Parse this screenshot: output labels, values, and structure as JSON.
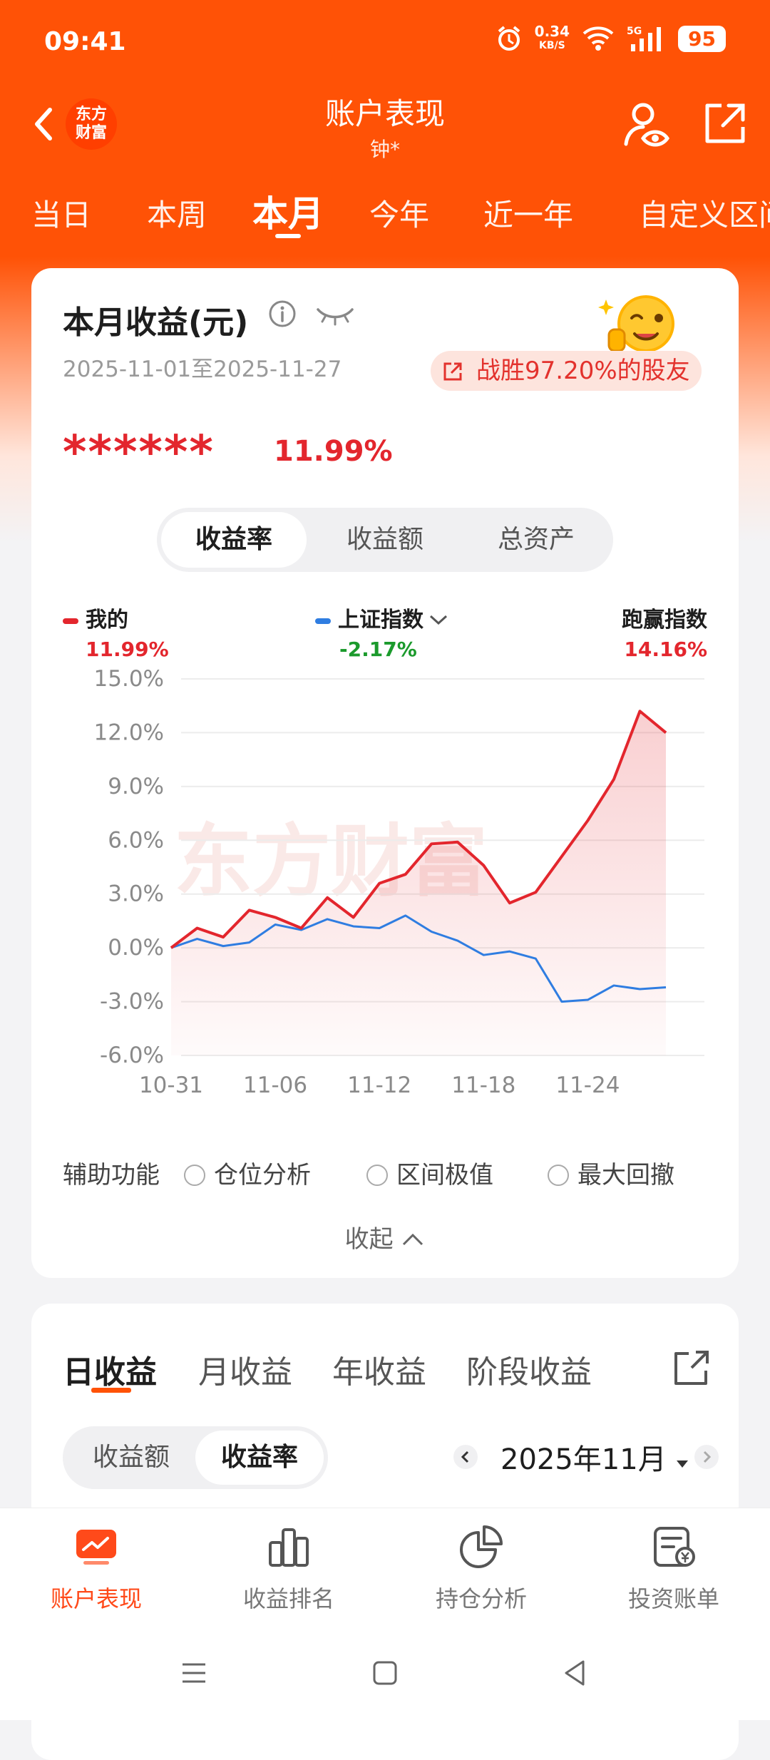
{
  "status": {
    "time": "09:41",
    "net_speed": "0.34",
    "net_unit": "KB/S",
    "signal": "5G",
    "battery": "95"
  },
  "nav": {
    "title": "账户表现",
    "subtitle": "钟*",
    "logo": "东方\n财富"
  },
  "period_tabs": [
    "当日",
    "本周",
    "本月",
    "今年",
    "近一年",
    "自定义区间"
  ],
  "period_active": "本月",
  "summary": {
    "title": "本月收益(元)",
    "date_range": "2025-11-01至2025-11-27",
    "beat_text": "战胜97.20%的股友",
    "masked_amount": "******",
    "return_pct": "11.99%"
  },
  "segments": [
    "收益率",
    "收益额",
    "总资产"
  ],
  "segment_active": "收益率",
  "legend": [
    {
      "name": "我的",
      "value": "11.99%",
      "color": "#e3262d"
    },
    {
      "name": "上证指数",
      "value": "-2.17%",
      "color": "#2f7de1"
    },
    {
      "name": "跑赢指数",
      "value": "14.16%",
      "color": "#e3262d"
    }
  ],
  "chart_data": {
    "type": "line",
    "y_ticks": [
      "15.0%",
      "12.0%",
      "9.0%",
      "6.0%",
      "3.0%",
      "0.0%",
      "-3.0%",
      "-6.0%"
    ],
    "x_ticks": [
      "10-31",
      "11-06",
      "11-12",
      "11-18",
      "11-24"
    ],
    "ylim": [
      -6,
      15
    ],
    "x": [
      "10-31",
      "11-03",
      "11-04",
      "11-05",
      "11-06",
      "11-07",
      "11-10",
      "11-11",
      "11-12",
      "11-13",
      "11-14",
      "11-17",
      "11-18",
      "11-19",
      "11-20",
      "11-21",
      "11-24",
      "11-25",
      "11-26",
      "11-27"
    ],
    "series": [
      {
        "name": "我的",
        "color": "#e3262d",
        "values": [
          0.0,
          1.1,
          0.6,
          2.1,
          1.7,
          1.1,
          2.8,
          1.7,
          3.6,
          4.1,
          5.8,
          5.9,
          4.6,
          2.5,
          3.1,
          5.1,
          7.1,
          9.4,
          13.2,
          12.0
        ]
      },
      {
        "name": "上证指数",
        "color": "#2f7de1",
        "values": [
          0.0,
          0.5,
          0.1,
          0.3,
          1.3,
          1.0,
          1.6,
          1.2,
          1.1,
          1.8,
          0.9,
          0.4,
          -0.4,
          -0.2,
          -0.6,
          -3.0,
          -2.9,
          -2.1,
          -2.3,
          -2.2
        ]
      }
    ],
    "watermark": "东方财富"
  },
  "aux": {
    "label": "辅助功能",
    "options": [
      "仓位分析",
      "区间极值",
      "最大回撤"
    ],
    "collapse": "收起"
  },
  "earnings": {
    "tabs": [
      "日收益",
      "月收益",
      "年收益",
      "阶段收益"
    ],
    "tab_active": "日收益",
    "toggle": [
      "收益额",
      "收益率"
    ],
    "toggle_active": "收益率",
    "month": "2025年11月"
  },
  "bottom_nav": [
    {
      "label": "账户表现",
      "icon": "chart-trend-icon",
      "active": true
    },
    {
      "label": "收益排名",
      "icon": "bar-ranking-icon",
      "active": false
    },
    {
      "label": "持仓分析",
      "icon": "pie-chart-icon",
      "active": false
    },
    {
      "label": "投资账单",
      "icon": "bill-icon",
      "active": false
    }
  ]
}
